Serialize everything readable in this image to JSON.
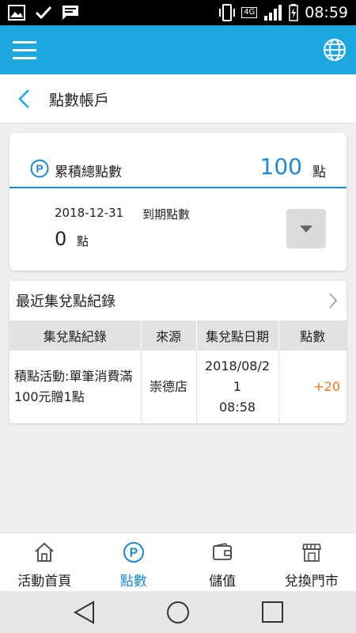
{
  "status_bar": {
    "time": "08:59",
    "network": "4G",
    "icons": [
      "image-icon",
      "check-icon",
      "message-icon",
      "vibrate-icon",
      "signal-icon",
      "battery-charging-icon"
    ]
  },
  "app_bar": {
    "menu_icon": "menu-icon",
    "globe_icon": "globe-icon"
  },
  "subheader": {
    "title": "點數帳戶"
  },
  "points_card": {
    "total_label": "累積總點數",
    "total_value": "100",
    "total_unit": "點",
    "expiry_date": "2018-12-31",
    "expiry_label": "到期點數",
    "expiry_value": "0",
    "expiry_unit": "點"
  },
  "recent": {
    "title": "最近集兌點紀錄",
    "columns": [
      "集兌點紀錄",
      "來源",
      "集兌點日期",
      "點數"
    ],
    "rows": [
      {
        "description": "積點活動:單筆消費滿100元贈1點",
        "source": "崇德店",
        "date_line1": "2018/08/2",
        "date_line2": "1",
        "date_line3": "08:58",
        "points": "+20"
      }
    ]
  },
  "bottom_nav": {
    "items": [
      {
        "label": "活動首頁",
        "icon": "home-icon"
      },
      {
        "label": "點數",
        "icon": "points-icon"
      },
      {
        "label": "儲值",
        "icon": "wallet-icon"
      },
      {
        "label": "兌換門市",
        "icon": "store-icon"
      }
    ],
    "active_index": 1
  },
  "colors": {
    "accent": "#1ea7e1",
    "points_blue": "#1e88d0",
    "points_orange": "#f07d1a"
  }
}
